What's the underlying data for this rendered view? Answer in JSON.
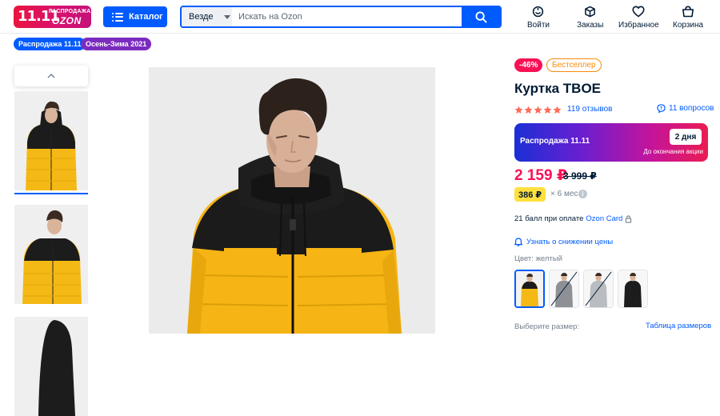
{
  "header": {
    "logo": {
      "sale_number": "11.11",
      "sale_label": "РАСПРОДАЖА",
      "brand": "OZON"
    },
    "catalog_label": "Каталог",
    "search": {
      "scope": "Везде",
      "placeholder": "Искать на Ozon"
    },
    "nav": [
      {
        "label": "Войти",
        "icon": "smile-user-icon"
      },
      {
        "label": "Заказы",
        "icon": "box-icon"
      },
      {
        "label": "Избранное",
        "icon": "heart-icon"
      },
      {
        "label": "Корзина",
        "icon": "basket-icon"
      }
    ],
    "accent": "#005bff"
  },
  "chips": [
    {
      "label": "Распродажа 11.11",
      "color": "#005bff"
    },
    {
      "label": "Осень-Зима 2021",
      "color": "#7b2cbf"
    }
  ],
  "product": {
    "discount_badge": "-46%",
    "bestseller_badge": "Бестселлер",
    "title": "Куртка TBOE",
    "rating_stars": 5,
    "reviews": "119 отзывов",
    "questions": "11 вопросов",
    "promo": {
      "title": "Распродажа 11.11",
      "days": "2 дня",
      "until": "До окончания акции"
    },
    "price": "2 159 ₽",
    "old_price": "3 999 ₽",
    "installment": {
      "amount": "386 ₽",
      "multiplier": "× 6 мес"
    },
    "points": {
      "text": "21 балл при оплате",
      "card": "Ozon Card"
    },
    "notify": "Узнать о снижении цены",
    "color_label": "Цвет: желтый",
    "swatches": [
      {
        "color": "yellow",
        "selected": true,
        "available": true
      },
      {
        "color": "grey",
        "selected": false,
        "available": false
      },
      {
        "color": "light-grey",
        "selected": false,
        "available": false
      },
      {
        "color": "black",
        "selected": false,
        "available": true
      }
    ],
    "size_label": "Выберите размер:",
    "size_table": "Таблица размеров"
  }
}
